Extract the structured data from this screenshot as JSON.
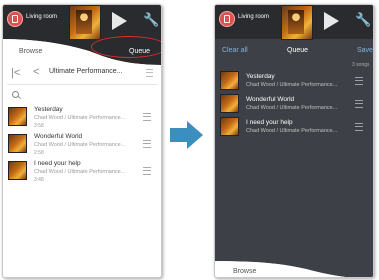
{
  "left": {
    "room_label": "Living room",
    "tabs": {
      "browse": "Browse",
      "queue": "Queue"
    },
    "toolbar": {
      "title": "Ultimate Performance..."
    },
    "tracks": [
      {
        "title": "Yesterday",
        "subtitle": "Chad Wood / Ultimate Performance...",
        "duration": "3:58"
      },
      {
        "title": "Wonderful World",
        "subtitle": "Chad Wood / Ultimate Performance...",
        "duration": "2:58"
      },
      {
        "title": "I need your help",
        "subtitle": "Chad Wood / Ultimate Performance...",
        "duration": "3:48"
      }
    ]
  },
  "right": {
    "room_label": "Living room",
    "header": {
      "clear_all": "Clear all",
      "title": "Queue",
      "save": "Save"
    },
    "song_count": "3 songs",
    "tracks": [
      {
        "title": "Yesterday",
        "subtitle": "Chad Wood / Ultimate Performance..."
      },
      {
        "title": "Wonderful World",
        "subtitle": "Chad Wood / Ultimate Performance..."
      },
      {
        "title": "I need your help",
        "subtitle": "Chad Wood / Ultimate Performance..."
      }
    ],
    "footer": {
      "browse": "Browse"
    }
  },
  "colors": {
    "accent_arrow": "#3a8fbf",
    "highlight_oval": "#e02b2b",
    "link": "#7fb2de",
    "room_icon": "#d9534f"
  },
  "icons": [
    "room-icon",
    "play-icon",
    "wrench-icon",
    "skip-start-icon",
    "back-icon",
    "menu-icon",
    "search-icon",
    "drag-handle-icon",
    "arrow-right-icon"
  ]
}
